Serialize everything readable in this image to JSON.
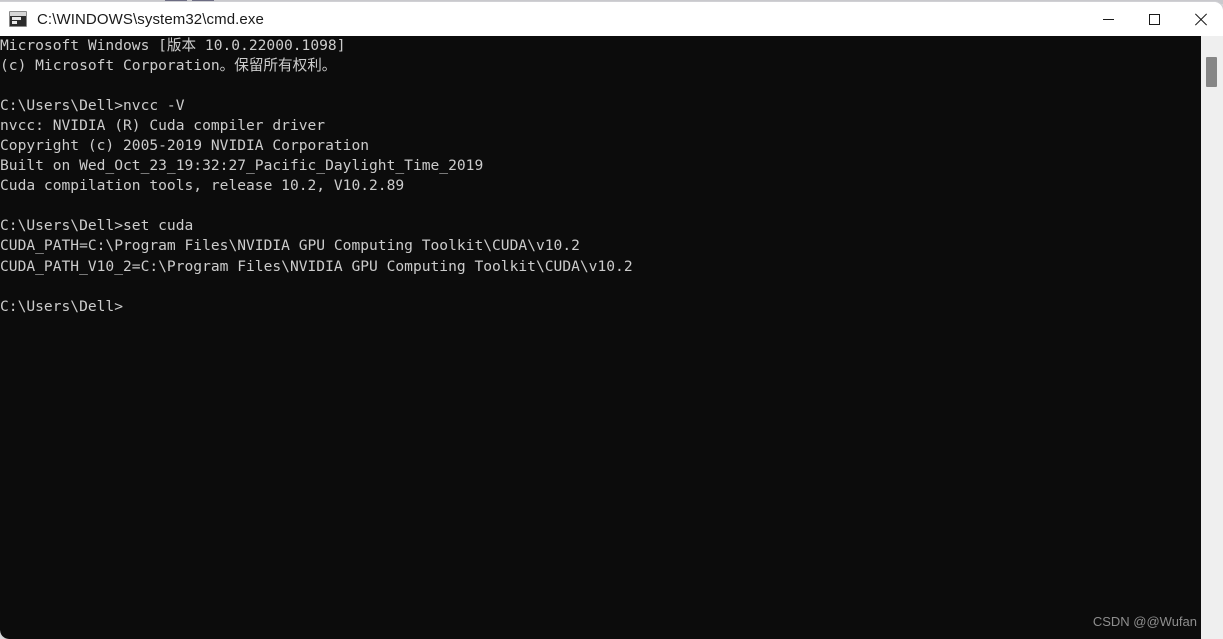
{
  "window": {
    "title": "C:\\WINDOWS\\system32\\cmd.exe",
    "icon": "cmd-console-icon",
    "colors": {
      "titlebar_bg": "#ffffff",
      "console_bg": "#0c0c0c",
      "console_fg": "#cccccc",
      "scrollbar_track": "#efefef",
      "scrollbar_thumb": "#868686"
    },
    "controls": {
      "minimize_label": "—",
      "maximize_label": "□",
      "close_label": "✕"
    }
  },
  "console": {
    "lines": [
      "Microsoft Windows [版本 10.0.22000.1098]",
      "(c) Microsoft Corporation。保留所有权利。",
      "",
      "C:\\Users\\Dell>nvcc -V",
      "nvcc: NVIDIA (R) Cuda compiler driver",
      "Copyright (c) 2005-2019 NVIDIA Corporation",
      "Built on Wed_Oct_23_19:32:27_Pacific_Daylight_Time_2019",
      "Cuda compilation tools, release 10.2, V10.2.89",
      "",
      "C:\\Users\\Dell>set cuda",
      "CUDA_PATH=C:\\Program Files\\NVIDIA GPU Computing Toolkit\\CUDA\\v10.2",
      "CUDA_PATH_V10_2=C:\\Program Files\\NVIDIA GPU Computing Toolkit\\CUDA\\v10.2",
      "",
      "C:\\Users\\Dell>"
    ],
    "text": "Microsoft Windows [版本 10.0.22000.1098]\n(c) Microsoft Corporation。保留所有权利。\n\nC:\\Users\\Dell>nvcc -V\nnvcc: NVIDIA (R) Cuda compiler driver\nCopyright (c) 2005-2019 NVIDIA Corporation\nBuilt on Wed_Oct_23_19:32:27_Pacific_Daylight_Time_2019\nCuda compilation tools, release 10.2, V10.2.89\n\nC:\\Users\\Dell>set cuda\nCUDA_PATH=C:\\Program Files\\NVIDIA GPU Computing Toolkit\\CUDA\\v10.2\nCUDA_PATH_V10_2=C:\\Program Files\\NVIDIA GPU Computing Toolkit\\CUDA\\v10.2\n\nC:\\Users\\Dell>"
  },
  "watermark": {
    "text": "CSDN @@Wufan"
  }
}
